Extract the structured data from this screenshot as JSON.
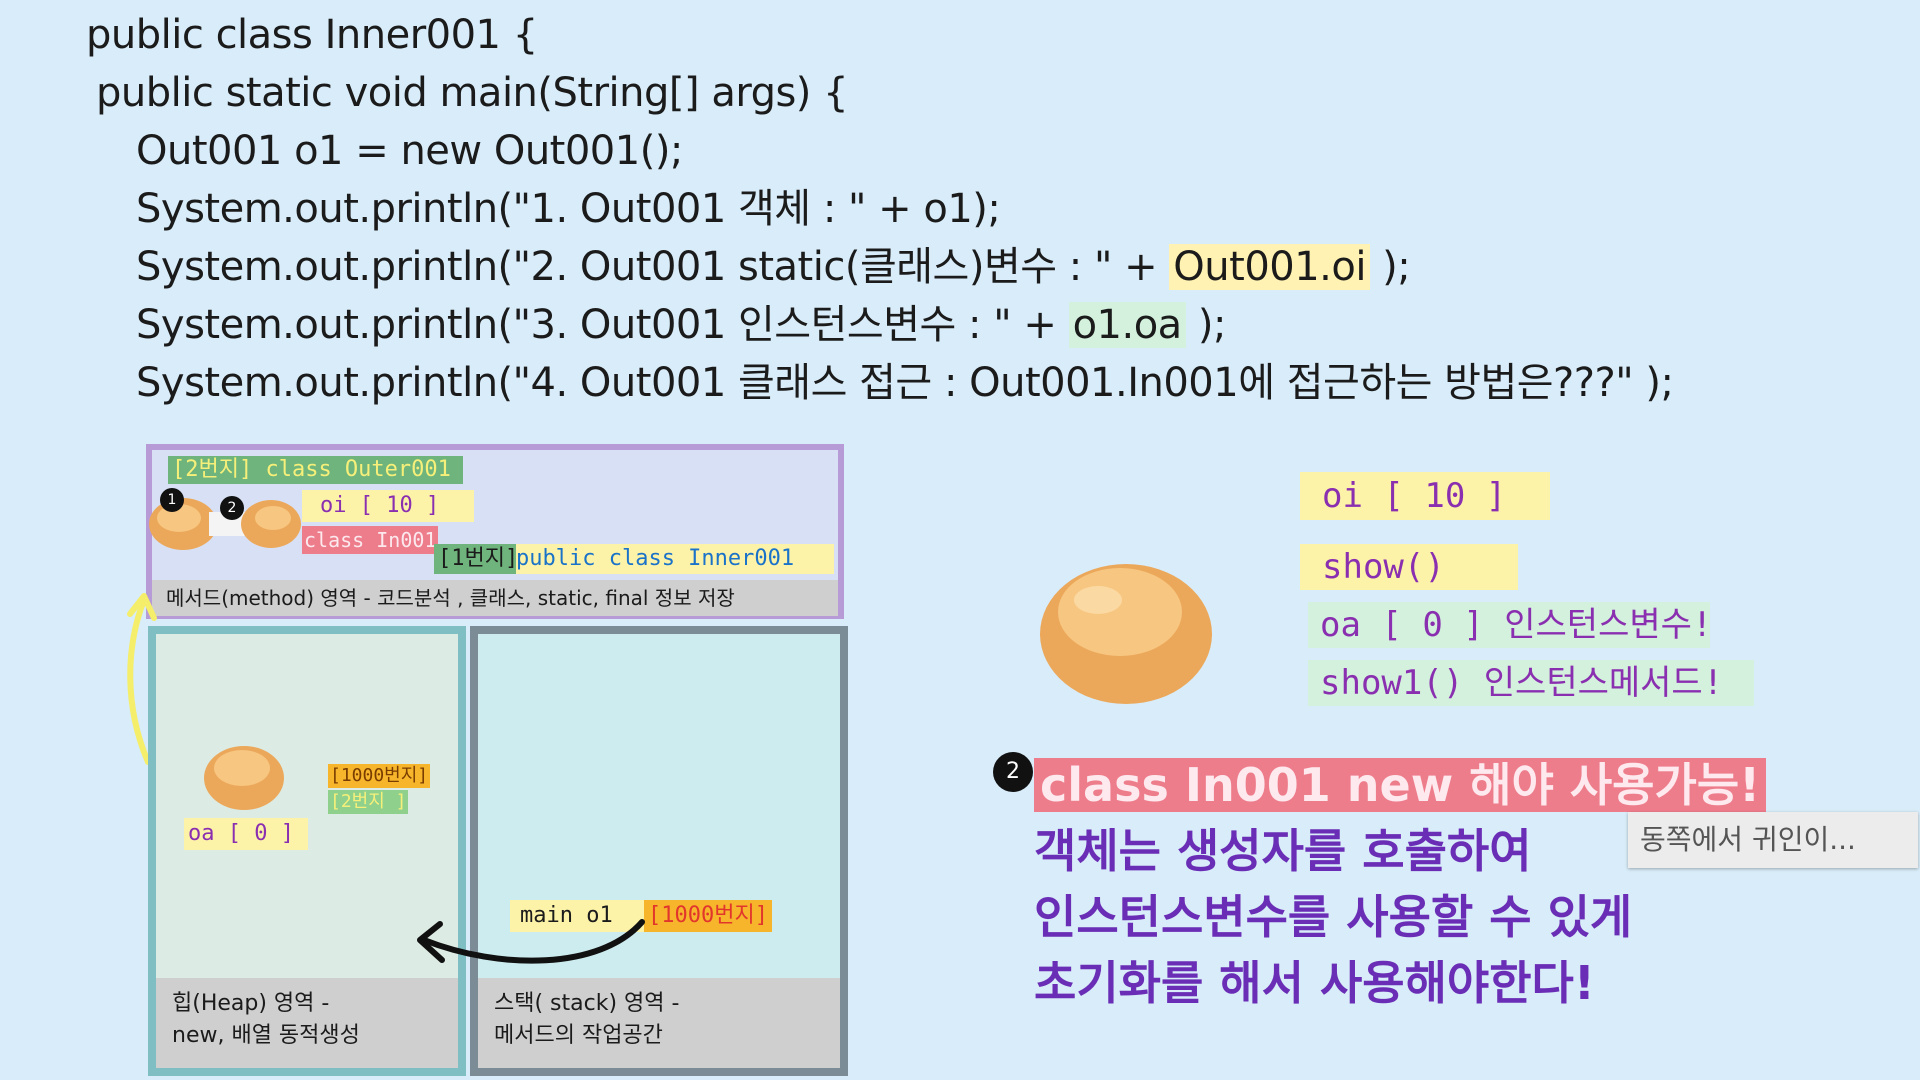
{
  "code": {
    "line1": "public class Inner001 {",
    "line2": " public static void main(String[] args) {",
    "line3": "Out001 o1 = new Out001();",
    "line4": "System.out.println(\"1. Out001 객체 : \" + o1);",
    "line5_prefix": "System.out.println(\"2. Out001 static(클래스)변수 : \" + ",
    "line5_highlight": "Out001.oi",
    "line5_suffix": " );",
    "line6_prefix": "System.out.println(\"3. Out001 인스턴스변수 : \" + ",
    "line6_highlight": "o1.oa",
    "line6_suffix": " );",
    "line7": "System.out.println(\"4. Out001 클래스 접근 : Out001.In001에 접근하는 방법은???\" );"
  },
  "method_area": {
    "tag_2": "[2번지]  class  Outer001",
    "oi_tag": "oi [ 10 ]",
    "in001_tag": "class In001",
    "tag_1_addr": "[1번지]",
    "tag_1_class": " public class  Inner001",
    "badge1": "1",
    "badge2": "2",
    "footer": "메서드(method) 영역  - 코드분석 , 클래스, static, final 정보 저장"
  },
  "heap": {
    "addr1000": "[1000번지]",
    "addr2": "[2번지     ]",
    "oa_tag": "oa [ 0 ]",
    "footer_line1": "힙(Heap) 영역 -",
    "footer_line2": " new, 배열 동적생성"
  },
  "stack": {
    "main_label": "main   o1",
    "main_addr": "[1000번지]",
    "footer_line1": "스택( stack) 영역 -",
    "footer_line2": "메서드의 작업공간"
  },
  "right_panel": {
    "oi": "oi [ 10 ]",
    "show": "show()",
    "oa": "oa [ 0 ] 인스턴스변수!",
    "show1": "show1() 인스턴스메서드!"
  },
  "note": {
    "badge": "2",
    "line1": "class  In001 new 해야 사용가능!",
    "line2": "객체는  생성자를 호출하여",
    "line3": "인스턴스변수를 사용할 수 있게",
    "line4": "초기화를 해서 사용해야한다!"
  },
  "tooltip": "동쪽에서 귀인이..."
}
